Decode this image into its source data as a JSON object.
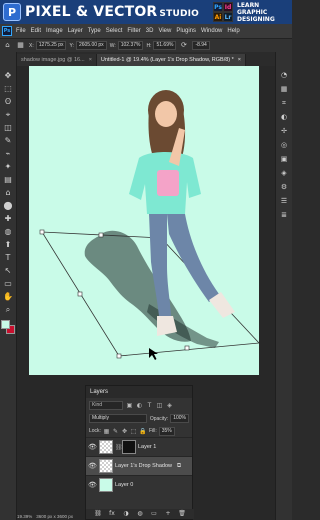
{
  "brand": {
    "logo_glyph": "P",
    "title": "PIXEL & VECTOR",
    "studio": "STUDIO",
    "tagline": [
      "LEARN",
      "GRAPHIC",
      "DESIGNING"
    ],
    "badges": [
      "Ps",
      "Id",
      "Ai",
      "Lr"
    ]
  },
  "app": {
    "badge": "Ps",
    "menu": [
      "File",
      "Edit",
      "Image",
      "Layer",
      "Type",
      "Select",
      "Filter",
      "3D",
      "View",
      "Plugins",
      "Window",
      "Help"
    ]
  },
  "options": {
    "x_label": "X:",
    "x_value": "1275.25 px",
    "y_label": "Y:",
    "y_value": "2605.00 px",
    "w_label": "W:",
    "w_value": "102.37%",
    "h_label": "H:",
    "h_value": "51.69%",
    "angle_value": "-8.94"
  },
  "tabs": [
    {
      "label": "shadow image.jpg @ 16...",
      "close": "×"
    },
    {
      "label": "Untitled-1 @ 19.4% (Layer 1's Drop Shadow, RGB/8) *",
      "close": "×"
    }
  ],
  "tools": [
    "✥",
    "⬚",
    "ʘ",
    "⌖",
    "◫",
    "✎",
    "⌁",
    "✦",
    "▤",
    "⌂",
    "⬤",
    "✚",
    "◍",
    "⬆",
    "T",
    "↖",
    "▭",
    "✋",
    "⌕"
  ],
  "dock": [
    "◔",
    "▦",
    "⌗",
    "◐",
    "✢",
    "◎",
    "▣",
    "◈",
    "⚙",
    "☰",
    "≣"
  ],
  "colors": {
    "foreground": "#c8fbe8",
    "background": "#c8102e",
    "canvas": "#c9fbe8"
  },
  "layers_panel": {
    "title": "Layers",
    "filter_placeholder": "Kind",
    "filter_icons": [
      "▣",
      "◐",
      "T",
      "◫",
      "◈"
    ],
    "blend_mode": "Multiply",
    "opacity_label": "Opacity:",
    "opacity_value": "100%",
    "lock_label": "Lock:",
    "fill_label": "Fill:",
    "fill_value": "35%",
    "layers": [
      {
        "name": "Layer 1",
        "visible": true,
        "selected": false,
        "thumb": "checker",
        "has_mask": true
      },
      {
        "name": "Layer 1's Drop Shadow",
        "visible": true,
        "selected": true,
        "thumb": "checker",
        "has_fx": true
      },
      {
        "name": "Layer 0",
        "visible": true,
        "selected": false,
        "thumb": "mint"
      }
    ],
    "footer_icons": [
      "⛓",
      "fx",
      "◑",
      "◍",
      "▭",
      "+",
      "🗑"
    ]
  },
  "status": {
    "zoom": "19.39%",
    "doc": "3600 px x 3600 px"
  }
}
